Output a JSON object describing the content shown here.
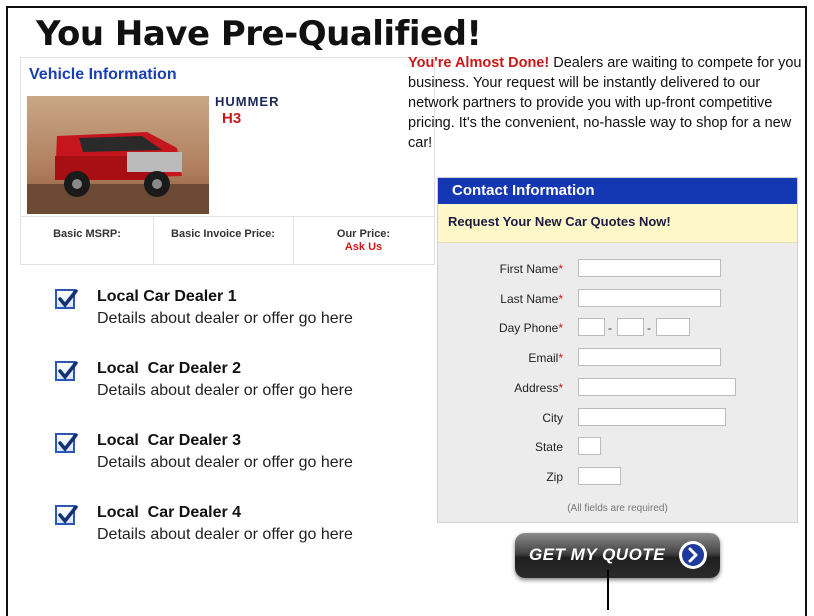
{
  "headline": "You Have Pre-Qualified!",
  "vehicle": {
    "title": "Vehicle Information",
    "brand": "HUMMER",
    "model": "H3",
    "msrp_label": "Basic MSRP:",
    "invoice_label": "Basic Invoice Price:",
    "our_price_label": "Our Price:",
    "our_price_value": "Ask Us"
  },
  "dealers": [
    {
      "name": "Local Car Dealer 1",
      "desc": "Details about dealer or offer go here",
      "checked": true
    },
    {
      "name": "Local  Car Dealer 2",
      "desc": "Details about dealer or offer go here",
      "checked": true
    },
    {
      "name": "Local  Car Dealer 3",
      "desc": "Details about dealer or offer go here",
      "checked": true
    },
    {
      "name": "Local  Car Dealer 4",
      "desc": "Details about dealer or offer go here",
      "checked": true
    }
  ],
  "intro": {
    "highlight": "You're Almost Done!",
    "body": " Dealers are waiting to compete for you business. Your request will be instantly delivered to our network partners to provide you with up-front competitive pricing. It's the convenient, no-hassle way to shop for a new car!"
  },
  "contact": {
    "header": "Contact Information",
    "subheader": "Request Your New Car Quotes Now!",
    "fields": {
      "first_name": "First Name",
      "last_name": "Last Name",
      "day_phone": "Day Phone",
      "email": "Email",
      "address": "Address",
      "city": "City",
      "state": "State",
      "zip": "Zip"
    },
    "required_mark": "*",
    "phone_sep": "-",
    "note": "(All fields are required)"
  },
  "cta": {
    "label": "GET MY QUOTE"
  },
  "colors": {
    "accent_blue": "#1438b4",
    "accent_red": "#c81818",
    "note_bg": "#fef8c8"
  }
}
